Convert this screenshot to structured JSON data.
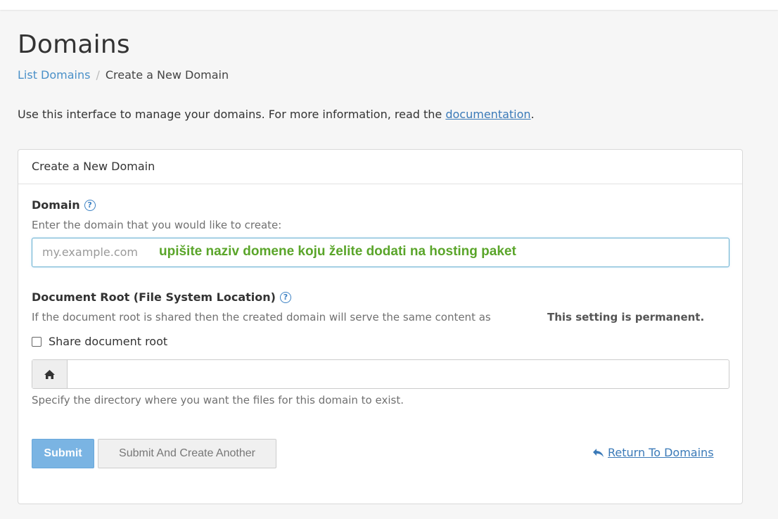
{
  "header": {
    "title": "Domains"
  },
  "breadcrumb": {
    "items": [
      {
        "label": "List Domains"
      },
      {
        "label": "Create a New Domain"
      }
    ]
  },
  "intro": {
    "text": "Use this interface to manage your domains. For more information, read the ",
    "link": "documentation",
    "suffix": "."
  },
  "panel": {
    "title": "Create a New Domain",
    "domain": {
      "label": "Domain",
      "hint": "Enter the domain that you would like to create:",
      "placeholder": "my.example.com",
      "annotation": "upišite naziv domene koju želite dodati na hosting paket"
    },
    "docroot": {
      "label": "Document Root (File System Location)",
      "hint": "If the document root is shared then the created domain will serve the same content as",
      "permanent": "This setting is permanent.",
      "share_label": "Share document root",
      "share_checked": false,
      "value": "",
      "specify_hint": "Specify the directory where you want the files for this domain to exist."
    },
    "buttons": {
      "submit": "Submit",
      "submit_another": "Submit And Create Another",
      "return": "Return To Domains"
    }
  },
  "colors": {
    "link": "#3b7ab8",
    "annotation": "#5aa52a",
    "submit_bg": "#7ab4e3"
  },
  "icons": {
    "help": "question-circle-icon",
    "home": "home-icon",
    "return": "reply-arrow-icon"
  }
}
